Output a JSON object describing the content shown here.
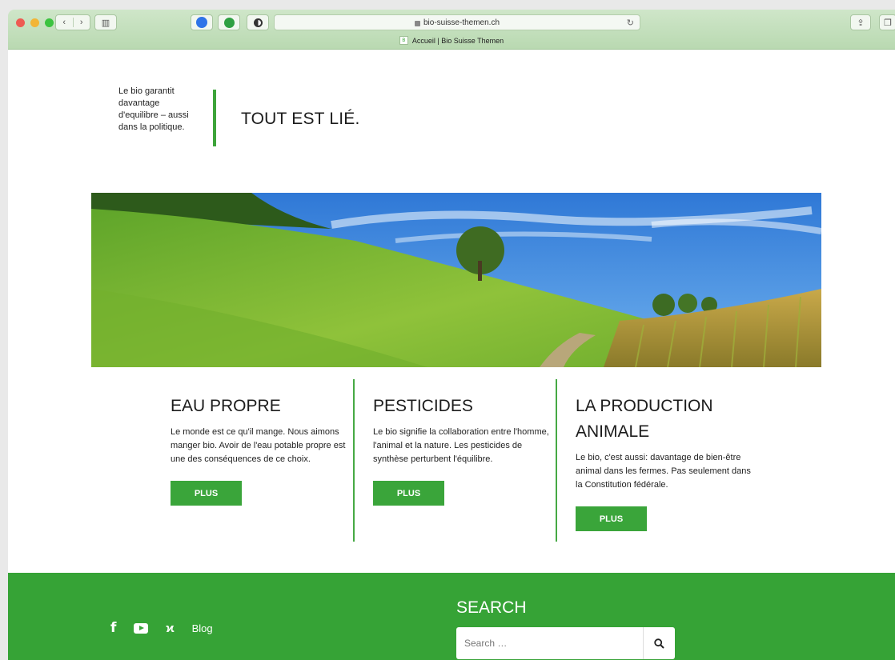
{
  "browser": {
    "url": "bio-suisse-themen.ch",
    "tab_title": "Accueil | Bio Suisse Themen"
  },
  "header": {
    "tagline": "Le bio garantit davantage d'equilibre – aussi dans la politique.",
    "title": "TOUT EST LIÉ.",
    "accent_color": "#3da43a"
  },
  "columns": [
    {
      "title": "EAU PROPRE",
      "text": "Le monde est ce qu'il mange. Nous aimons manger bio. Avoir de l'eau potable propre est une des conséquences de ce choix.",
      "button": "PLUS"
    },
    {
      "title": "PESTICIDES",
      "text": "Le bio signifie la collaboration entre l'homme, l'animal et la nature. Les pesticides de synthèse perturbent l'équilibre.",
      "button": "PLUS"
    },
    {
      "title": "LA PRODUCTION ANIMALE",
      "text": "Le bio, c'est aussi: davantage de bien-être animal dans les fermes. Pas seulement dans la Constitution fédérale.",
      "button": "PLUS"
    }
  ],
  "footer": {
    "background": "#36a336",
    "social_icons": [
      "facebook-icon",
      "youtube-icon",
      "xing-icon"
    ],
    "blog_label": "Blog",
    "search_heading": "SEARCH",
    "search_placeholder": "Search …"
  }
}
